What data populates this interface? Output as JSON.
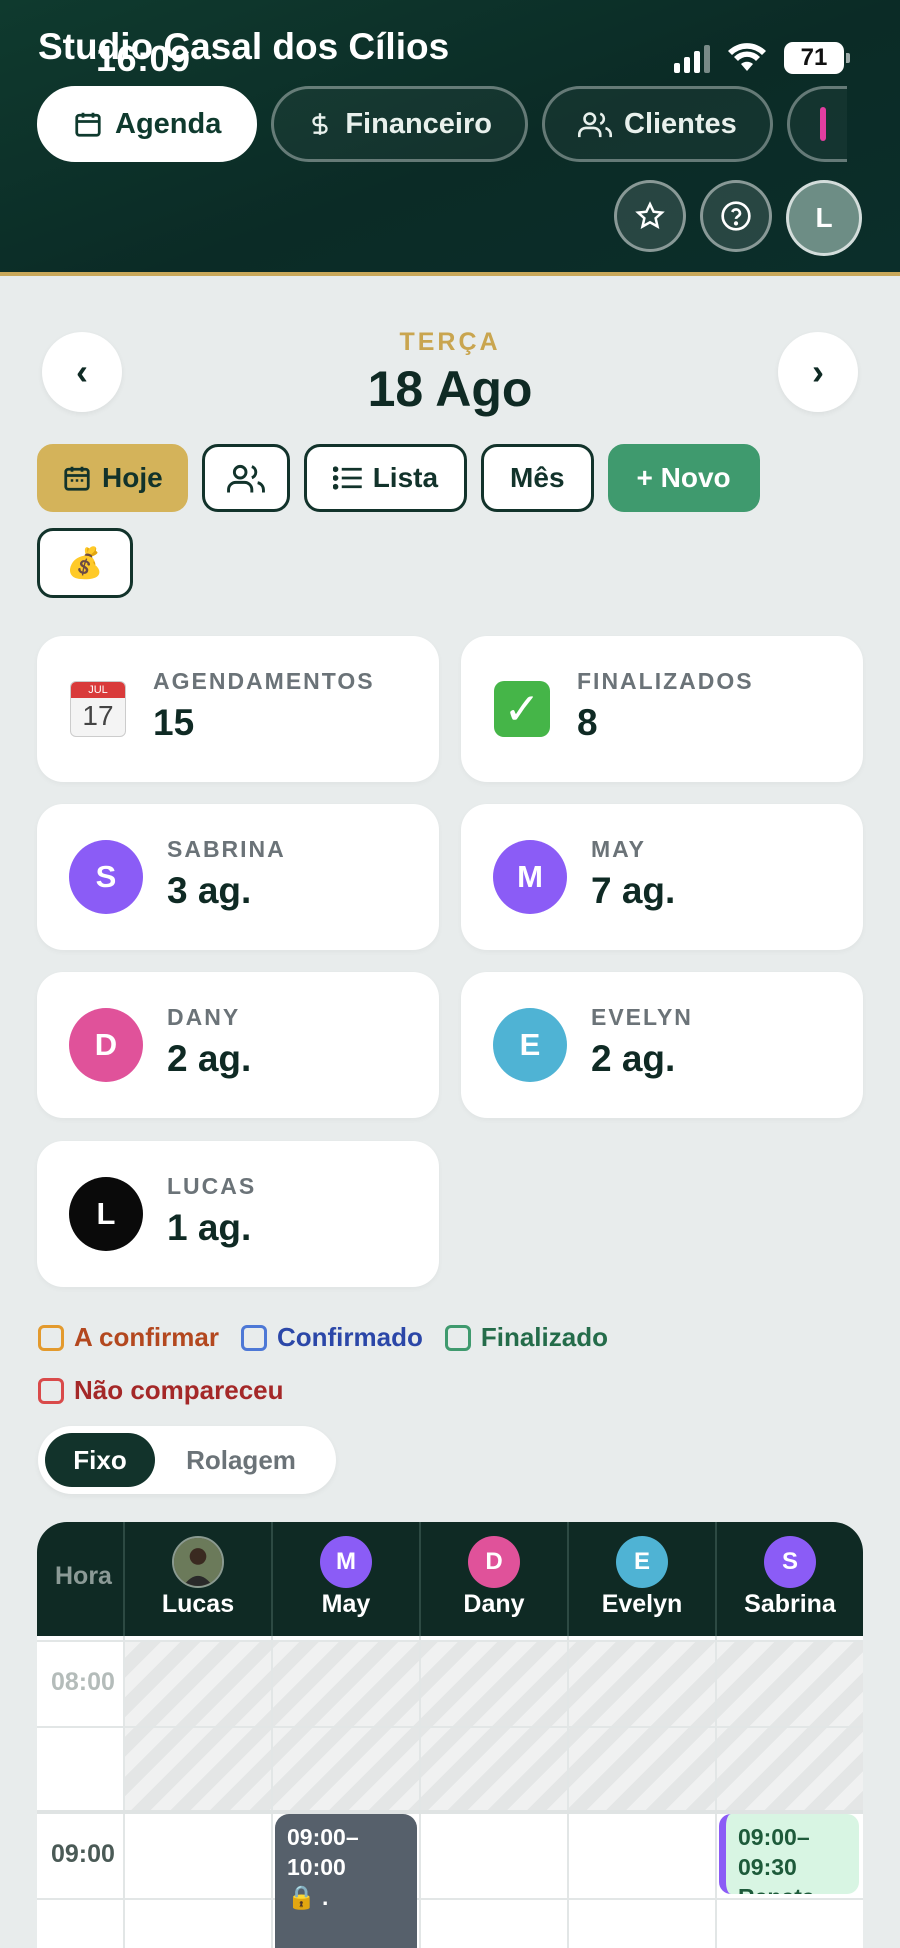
{
  "status_bar": {
    "time": "16:09",
    "battery": "71"
  },
  "app": {
    "title": "Studio Casal dos Cílios"
  },
  "nav_tabs": [
    {
      "label": "Agenda",
      "icon": "calendar-icon",
      "active": true
    },
    {
      "label": "Financeiro",
      "icon": "dollar-icon",
      "active": false
    },
    {
      "label": "Clientes",
      "icon": "users-icon",
      "active": false
    }
  ],
  "header_actions": {
    "avatar_letter": "L"
  },
  "date_nav": {
    "day_name": "TERÇA",
    "date": "18 Ago",
    "prev": "‹",
    "next": "›"
  },
  "toolbar": {
    "today_label": "Hoje",
    "list_label": "Lista",
    "month_label": "Mês",
    "new_label": "+ Novo",
    "money_icon": "💰"
  },
  "stats": {
    "appointments": {
      "label": "AGENDAMENTOS",
      "value": "15"
    },
    "finished": {
      "label": "FINALIZADOS",
      "value": "8"
    }
  },
  "professionals": [
    {
      "letter": "S",
      "name": "SABRINA",
      "count": "3 ag.",
      "color": "#8b5cf6"
    },
    {
      "letter": "M",
      "name": "MAY",
      "count": "7 ag.",
      "color": "#8b5cf6"
    },
    {
      "letter": "D",
      "name": "DANY",
      "count": "2 ag.",
      "color": "#e0529a"
    },
    {
      "letter": "E",
      "name": "EVELYN",
      "count": "2 ag.",
      "color": "#4fb3d4"
    },
    {
      "letter": "L",
      "name": "LUCAS",
      "count": "1 ag.",
      "color": "#0a0a0a"
    }
  ],
  "legend": [
    {
      "label": "A confirmar",
      "color": "#e39a2d",
      "text_color": "#b3481f"
    },
    {
      "label": "Confirmado",
      "color": "#4d78d6",
      "text_color": "#2b47a8"
    },
    {
      "label": "Finalizado",
      "color": "#3f9a6e",
      "text_color": "#246c4a"
    },
    {
      "label": "Não compareceu",
      "color": "#d94a4a",
      "text_color": "#a42828"
    }
  ],
  "view_mode": {
    "fixed": "Fixo",
    "scroll": "Rolagem"
  },
  "schedule": {
    "hour_header": "Hora",
    "columns": [
      {
        "name": "Lucas",
        "letter": "",
        "color": "#5a4a3a",
        "photo": true
      },
      {
        "name": "May",
        "letter": "M",
        "color": "#8b5cf6"
      },
      {
        "name": "Dany",
        "letter": "D",
        "color": "#e0529a"
      },
      {
        "name": "Evelyn",
        "letter": "E",
        "color": "#4fb3d4"
      },
      {
        "name": "Sabrina",
        "letter": "S",
        "color": "#8b5cf6"
      }
    ],
    "times": [
      "08:00",
      "09:00"
    ],
    "appointments": [
      {
        "time_start": "09:00–",
        "time_end": "10:00",
        "note": "🔒 ."
      },
      {
        "time_start": "09:00–",
        "time_end": "09:30",
        "note": "Renata"
      }
    ]
  }
}
